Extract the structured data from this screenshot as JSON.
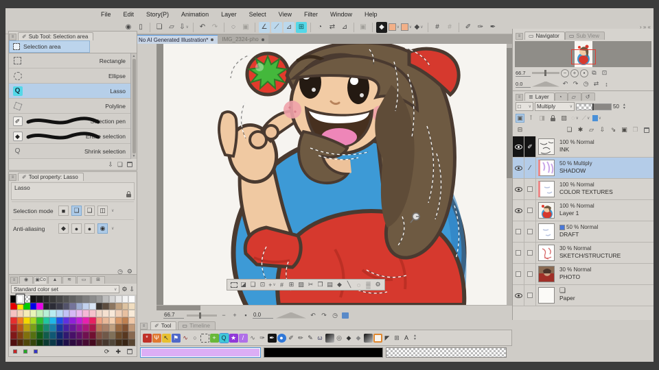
{
  "menu": {
    "items": [
      "File",
      "Edit",
      "Story(P)",
      "Animation",
      "Layer",
      "Select",
      "View",
      "Filter",
      "Window",
      "Help"
    ]
  },
  "toolbar": {
    "icons": [
      {
        "n": "csp-logo-icon",
        "g": "◉"
      },
      {
        "n": "tablet-mode-icon",
        "g": "▯"
      },
      {
        "n": "sep"
      },
      {
        "n": "new-file-icon",
        "g": "❏"
      },
      {
        "n": "open-file-icon",
        "g": "▱"
      },
      {
        "n": "export-icon",
        "g": "⇩",
        "dd": true
      },
      {
        "n": "sep"
      },
      {
        "n": "undo-icon",
        "g": "↶"
      },
      {
        "n": "redo-icon",
        "g": "↷",
        "dim": true
      },
      {
        "n": "sep"
      },
      {
        "n": "deselect-icon",
        "g": "◌"
      },
      {
        "n": "selection-border-icon",
        "g": "▣",
        "dim": true
      },
      {
        "n": "sep"
      },
      {
        "n": "snap-ruler-icon",
        "g": "∠",
        "hl": true
      },
      {
        "n": "snap-special-icon",
        "g": "⟋",
        "hl": true
      },
      {
        "n": "snap-grid-line-icon",
        "g": "⊿",
        "hl": true
      },
      {
        "n": "grid-icon",
        "g": "⊞",
        "cyan": true
      },
      {
        "n": "sep"
      },
      {
        "n": "rotate-view-icon",
        "g": "◔"
      },
      {
        "n": "flip-view-icon",
        "g": "⇄"
      },
      {
        "n": "snap-angle-icon",
        "g": "⊿"
      },
      {
        "n": "sep"
      },
      {
        "n": "screentone-icon",
        "g": "▣",
        "dim": true
      },
      {
        "n": "sep"
      },
      {
        "n": "main-color-icon",
        "g": "◆",
        "dark": true
      },
      {
        "n": "sub-color-chip",
        "chip": "#e8e6e2",
        "dd": true
      },
      {
        "n": "fg-color-chip",
        "chip": "#f2b astray",
        "dd": true
      },
      {
        "n": "gradient-icon",
        "g": "◆",
        "dd": true
      },
      {
        "n": "sep"
      },
      {
        "n": "transform-icon",
        "g": "#"
      },
      {
        "n": "mesh-transform-icon",
        "g": "#",
        "dim": true
      },
      {
        "n": "sep"
      },
      {
        "n": "pen-1-icon",
        "g": "✐"
      },
      {
        "n": "pen-2-icon",
        "g": "✑"
      },
      {
        "n": "pen-3-icon",
        "g": "✒"
      }
    ],
    "left_arrows": "« ‹",
    "right_arrows": "› » «"
  },
  "doc_tabs": [
    {
      "label": "No AI Generated Illustration*",
      "active": true
    },
    {
      "label": "IMG_2324-pho",
      "active": false
    }
  ],
  "subtool": {
    "title": "Sub Tool: Selection area",
    "group": "Selection area",
    "items": [
      {
        "label": "Rectangle",
        "icon": "dashrect"
      },
      {
        "label": "Ellipse",
        "icon": "dashcirc"
      },
      {
        "label": "Lasso",
        "icon": "lasso",
        "selected": true
      },
      {
        "label": "Polyline",
        "icon": "poly"
      },
      {
        "label": "Selection pen",
        "icon": "pen",
        "wave": true
      },
      {
        "label": "Erase selection",
        "icon": "erase",
        "wave": true
      },
      {
        "label": "Shrink selection",
        "icon": "shrink"
      }
    ]
  },
  "tool_property": {
    "title": "Tool property: Lasso",
    "tool_name": "Lasso",
    "selection_mode_label": "Selection mode",
    "antialiasing_label": "Anti-aliasing"
  },
  "color_set": {
    "selector_label": "Standard color set",
    "rows": [
      [
        "#000000",
        "SELW",
        "T",
        "#141414",
        "#1f1f1f",
        "#2b2b2b",
        "#383838",
        "#454545",
        "#525252",
        "#606060",
        "#6e6e6e",
        "#7d7d7d",
        "#8c8c8c",
        "#9b9b9b",
        "#bdbdbd",
        "#d6d6d6",
        "#e8e8e8",
        "#f4f4f4",
        "#fcfcfc"
      ],
      [
        "#e60000",
        "#ffe600",
        "#00cc00",
        "#0000e6",
        "#e600e6",
        "#22222a",
        "#2c2c36",
        "#3a3a48",
        "#52526a",
        "#74749a",
        "#9cacd0",
        "#c2d2ee",
        "#dae6f6",
        "#3a332e",
        "#5c4c3e",
        "#8c7660",
        "#c0a180",
        "#dcc2a0",
        "#f0ddc0"
      ],
      [
        "#f5c2c2",
        "#f5d6b8",
        "#f5ecb8",
        "#e8f5b8",
        "#c2f0b8",
        "#b8f0d6",
        "#b8ecf0",
        "#b8d6f5",
        "#c2c2f5",
        "#d6b8f5",
        "#ecb8f0",
        "#f5b8d6",
        "#f5c2cc",
        "#f0d8c8",
        "#f5e0d0",
        "#f8e8d8",
        "#f0d0b8",
        "#e8c0a0",
        "#f8ead8"
      ],
      [
        "#e62e2e",
        "#f07820",
        "#f5d800",
        "#a8d820",
        "#30c030",
        "#20c8a0",
        "#20b8e8",
        "#2050e8",
        "#6030e0",
        "#9020d8",
        "#c020d8",
        "#e820b0",
        "#e82060",
        "#f0a080",
        "#e8b898",
        "#f5d0b0",
        "#d89868",
        "#c08050",
        "#f0c8a8"
      ],
      [
        "#b02020",
        "#b85818",
        "#b8a010",
        "#78a018",
        "#208820",
        "#188870",
        "#1880a8",
        "#1838a0",
        "#4820a0",
        "#681898",
        "#901898",
        "#a81878",
        "#a81848",
        "#b87858",
        "#a88068",
        "#c0a080",
        "#986840",
        "#805030",
        "#c09878"
      ],
      [
        "#801818",
        "#804010",
        "#80700c",
        "#547010",
        "#145c14",
        "#105c4c",
        "#105874",
        "#102870",
        "#301870",
        "#481068",
        "#601068",
        "#701050",
        "#701030",
        "#805040",
        "#705848",
        "#807058",
        "#684828",
        "#583820",
        "#886850"
      ],
      [
        "#500f0f",
        "#50280a",
        "#504608",
        "#34460a",
        "#0c3a0c",
        "#0a3a30",
        "#0a3848",
        "#0a1848",
        "#1e0f48",
        "#2d0a40",
        "#3c0a40",
        "#460a32",
        "#460a1e",
        "#503228",
        "#46362c",
        "#504638",
        "#402c18",
        "#382414",
        "#584430"
      ]
    ],
    "footer_swatches": [
      "#cc2222",
      "#22aa22",
      "#3333cc"
    ]
  },
  "launcher": {
    "icons": [
      {
        "n": "deselect-icon",
        "cls": "lnc-dash"
      },
      {
        "n": "invert-selection-icon",
        "g": "◪"
      },
      {
        "n": "expand-selection-icon",
        "g": "❏"
      },
      {
        "n": "shrink-selection-icon",
        "g": "⊡"
      },
      {
        "n": "move-selection-icon",
        "g": "+",
        "dd": true
      },
      {
        "n": "scale-rotate-icon",
        "g": "#"
      },
      {
        "n": "mesh-transform-icon",
        "g": "⊞"
      },
      {
        "n": "fill-icon",
        "g": "▨"
      },
      {
        "n": "cut-icon",
        "g": "✂"
      },
      {
        "n": "copy-icon",
        "g": "❐"
      },
      {
        "n": "paste-icon",
        "g": "▤"
      },
      {
        "n": "gradient-icon",
        "g": "◆"
      },
      {
        "n": "line-icon",
        "g": "╲"
      },
      {
        "n": "halo-icon",
        "g": "◌"
      },
      {
        "n": "tone-icon",
        "g": "▒"
      },
      {
        "n": "launcher-settings-icon",
        "g": "⚙"
      }
    ]
  },
  "statusbar": {
    "zoom": "66.7",
    "rotation": "0.0",
    "minus": "−",
    "plus": "+",
    "fit": "▪",
    "undo_rot": "↶",
    "redo_rot": "↷",
    "reset_rot": "◷"
  },
  "bottom_tabs": {
    "tool": "Tool",
    "timeline": "Timeline"
  },
  "tool_palette": {
    "tools": [
      {
        "n": "zoom-tool",
        "g": "*",
        "bg": "#c03028",
        "fg": "#fff"
      },
      {
        "n": "move-screen-tool",
        "g": "Ψ",
        "bg": "#e07830",
        "fg": "#fff"
      },
      {
        "n": "operation-tool",
        "g": "↖",
        "bg": "#e8c030",
        "fg": "#333"
      },
      {
        "n": "layer-select-tool",
        "g": "⚑",
        "bg": "#5068c8",
        "fg": "#fff"
      },
      {
        "n": "frame-border-tool",
        "g": "∿",
        "fg": "#8a2828"
      },
      {
        "n": "figure-tool",
        "g": "○",
        "fg": "#555"
      },
      {
        "n": "marquee-tool",
        "cls": "dashedbox"
      },
      {
        "n": "move-layer-tool",
        "g": "+",
        "bg": "#68b838",
        "fg": "#fff"
      },
      {
        "n": "lasso-tool",
        "g": "Q",
        "bg": "#40c8d8",
        "fg": "#134",
        "active": true
      },
      {
        "n": "auto-select-tool",
        "g": "★",
        "bg": "#9038d8",
        "fg": "#fff"
      },
      {
        "n": "eyedropper-tool",
        "g": "/",
        "bg": "#b070e8",
        "fg": "#fff"
      },
      {
        "n": "curve-pen-tool",
        "g": "∿",
        "fg": "#666"
      },
      {
        "n": "pen-nib-tool",
        "g": "✑",
        "fg": "#555"
      },
      {
        "n": "ink-pen-tool",
        "g": "✒",
        "bg": "#141414",
        "fg": "#fff"
      },
      {
        "n": "airbrush-tool",
        "g": "●",
        "bg": "#3078d8",
        "fg": "#fff",
        "round": true
      },
      {
        "n": "brush-tool",
        "g": "✐",
        "fg": "#444"
      },
      {
        "n": "pencil-tool",
        "g": "✏",
        "fg": "#444"
      },
      {
        "n": "marker-tool",
        "g": "✎",
        "fg": "#444"
      },
      {
        "n": "decoration-tool",
        "g": "ω",
        "fg": "#446"
      },
      {
        "n": "dark-gradient-tool",
        "cls": "gradbox"
      },
      {
        "n": "blend-tool",
        "g": "◎",
        "fg": "#555"
      },
      {
        "n": "eraser-tool",
        "g": "◆",
        "fg": "#333"
      },
      {
        "n": "soft-eraser-tool",
        "g": "◆",
        "fg": "#888"
      },
      {
        "n": "gradient-tool",
        "cls": "gradbox"
      },
      {
        "n": "frame-tool",
        "cls": "orangebox"
      },
      {
        "n": "flag-tool",
        "g": "◤",
        "fg": "#444"
      },
      {
        "n": "perspective-grid-tool",
        "g": "⊞",
        "fg": "#555"
      },
      {
        "n": "text-tool",
        "g": "A",
        "fg": "#333"
      }
    ]
  },
  "colors": {
    "main": "#dcaef5",
    "sub": "#000000",
    "accent_blue": "#4a90d8",
    "highlight_cyan": "#54d8e8",
    "selection_blue": "#b4cce8"
  },
  "navigator": {
    "tabs": [
      {
        "label": "Navigator",
        "active": true
      },
      {
        "label": "Sub View",
        "active": false
      }
    ],
    "zoom": "66.7",
    "rotation": "0.0",
    "zoom_buttons": [
      "−",
      "+",
      "▪"
    ],
    "extra_icons": [
      "⧉",
      "⊡"
    ],
    "rotate_icons": [
      "↶",
      "↷",
      "◷",
      "⇄",
      "↕"
    ]
  },
  "layer_panel": {
    "tab": "Layer",
    "blend_mode": "Multiply",
    "opacity": "50",
    "layers": [
      {
        "name": "INK",
        "info": "100 % Normal",
        "eye": "on",
        "cell2": "pen",
        "thumb": "ink",
        "dark": true
      },
      {
        "name": "SHADOW",
        "info": "50 % Multiply",
        "eye": "on",
        "cell2": "pencil",
        "thumb": "shadow",
        "clip": true,
        "sel": true
      },
      {
        "name": "COLOR TEXTURES",
        "info": "100 % Normal",
        "eye": "on",
        "cell2": "box",
        "thumb": "checker",
        "clip": true
      },
      {
        "name": "Layer 1",
        "info": "100 % Normal",
        "eye": "on",
        "cell2": "box",
        "thumb": "art"
      },
      {
        "name": "DRAFT",
        "info": "50 % Normal",
        "eye": "box",
        "cell2": "box",
        "thumb": "checker",
        "badge": "draft"
      },
      {
        "name": "SKETCH/STRUCTURE",
        "info": "30 % Normal",
        "eye": "box",
        "cell2": "box",
        "thumb": "sketch"
      },
      {
        "name": "PHOTO",
        "info": "30 % Normal",
        "eye": "box",
        "cell2": "box",
        "thumb": "photo"
      },
      {
        "name": "Paper",
        "info": "",
        "eye": "on",
        "cell2": "box",
        "thumb": "paper",
        "badge": "paper"
      }
    ]
  },
  "artwork": {
    "skin": "#f2cba4",
    "hair": "#6e5a42",
    "hair_dark": "#5f4c38",
    "shirt": "#d6392e",
    "circle_blue": "#3d9ad6",
    "tomato": "#e23a2c",
    "leaf_green": "#44b83c",
    "outline": "#4a3a30",
    "mouth": "#47301f",
    "tongue": "#ee86b8",
    "blush": "#f0a2aa"
  }
}
